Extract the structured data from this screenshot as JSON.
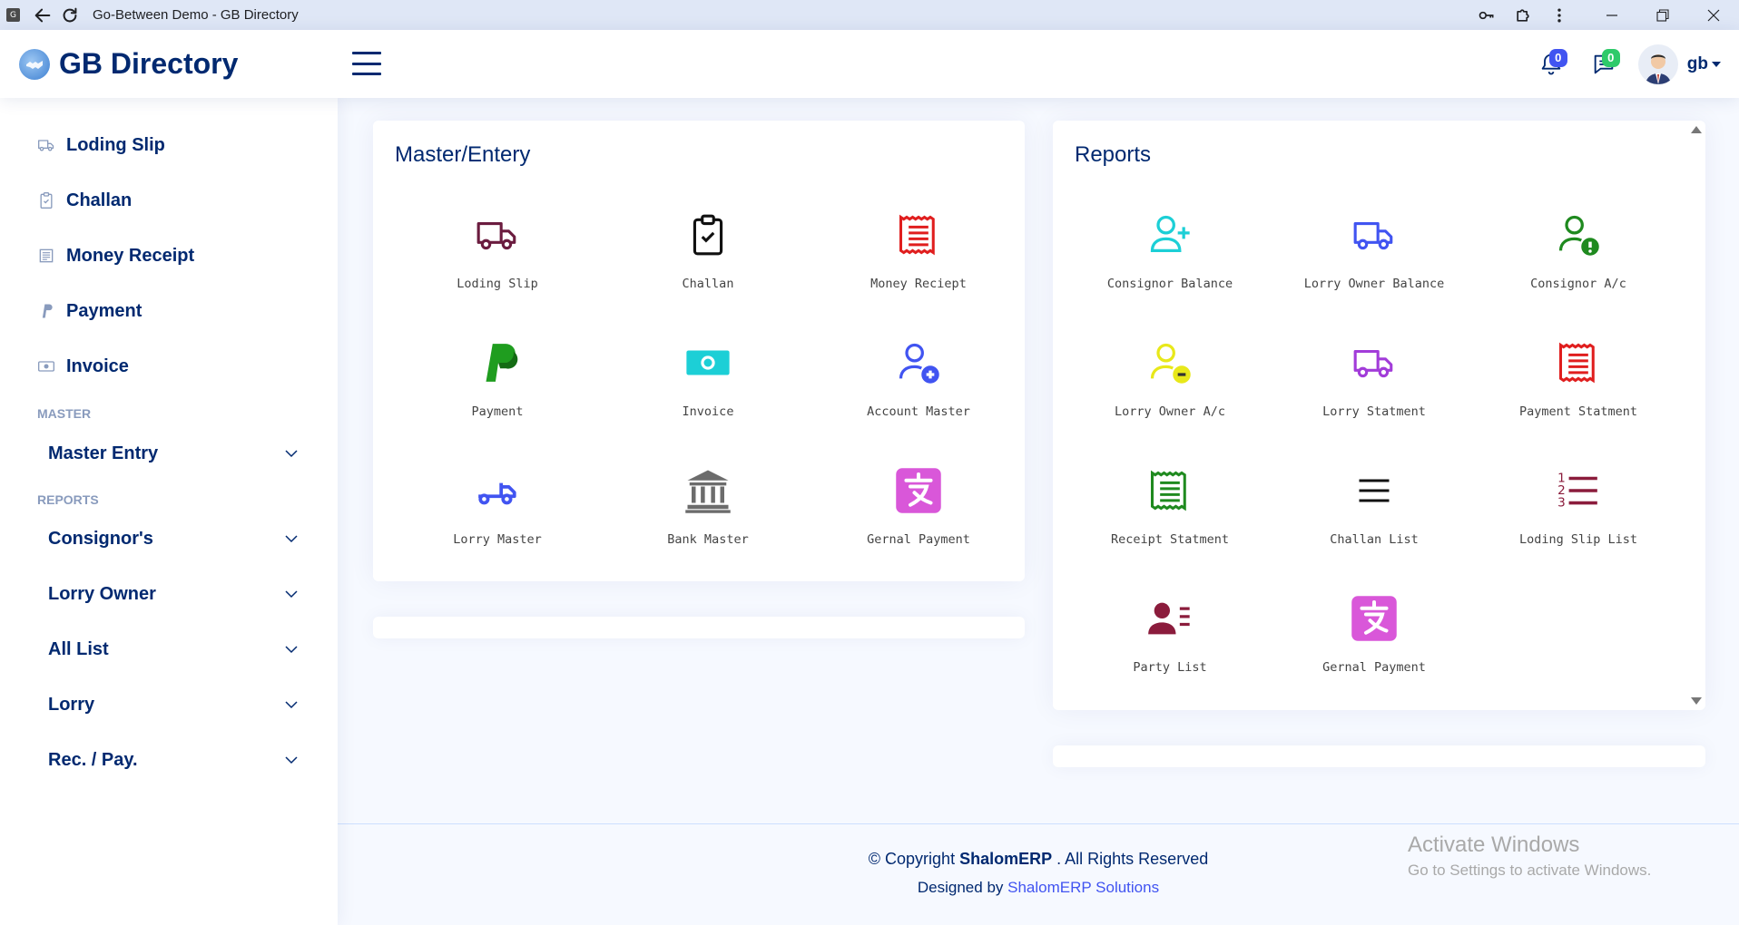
{
  "browser": {
    "title": "Go-Between Demo - GB Directory"
  },
  "header": {
    "logo_text": "GB Directory",
    "notifications_count": "0",
    "messages_count": "0",
    "user_name": "gb"
  },
  "sidebar": {
    "items": [
      {
        "label": "Loding Slip",
        "icon": "truck-icon"
      },
      {
        "label": "Challan",
        "icon": "clipboard-check-icon"
      },
      {
        "label": "Money Receipt",
        "icon": "receipt-icon"
      },
      {
        "label": "Payment",
        "icon": "paypal-icon"
      },
      {
        "label": "Invoice",
        "icon": "cash-icon"
      }
    ],
    "master_heading": "MASTER",
    "master_dropdowns": [
      {
        "label": "Master Entry"
      }
    ],
    "reports_heading": "REPORTS",
    "report_dropdowns": [
      {
        "label": "Consignor's"
      },
      {
        "label": "Lorry Owner"
      },
      {
        "label": "All List"
      },
      {
        "label": "Lorry"
      },
      {
        "label": "Rec. / Pay."
      }
    ]
  },
  "master_card": {
    "title": "Master/Entery",
    "tiles": [
      {
        "label": "Loding Slip",
        "icon": "truck-icon",
        "color": "#6b1c3f"
      },
      {
        "label": "Challan",
        "icon": "clipboard-check-icon",
        "color": "#111111"
      },
      {
        "label": "Money Reciept",
        "icon": "receipt-icon",
        "color": "#e01e1e"
      },
      {
        "label": "Payment",
        "icon": "paypal-icon",
        "color": "#1f9d1f"
      },
      {
        "label": "Invoice",
        "icon": "cash-icon",
        "color": "#1ccfd6"
      },
      {
        "label": "Account Master",
        "icon": "person-plus-icon",
        "color": "#4154f1"
      },
      {
        "label": "Lorry Master",
        "icon": "truck-flatbed-icon",
        "color": "#4154f1"
      },
      {
        "label": "Bank Master",
        "icon": "bank-icon",
        "color": "#6c6c6c"
      },
      {
        "label": "Gernal Payment",
        "icon": "alipay-icon",
        "color": "#d957d9"
      }
    ]
  },
  "reports_card": {
    "title": "Reports",
    "tiles": [
      {
        "label": "Consignor Balance",
        "icon": "person-plus-icon",
        "color": "#1ccfd6"
      },
      {
        "label": "Lorry Owner Balance",
        "icon": "truck-icon",
        "color": "#4154f1"
      },
      {
        "label": "Consignor A/c",
        "icon": "person-exclamation-icon",
        "color": "#1f8a1f"
      },
      {
        "label": "Lorry Owner A/c",
        "icon": "person-dash-icon",
        "color": "#e8e81a"
      },
      {
        "label": "Lorry Statment",
        "icon": "truck-icon",
        "color": "#a23cd9"
      },
      {
        "label": "Payment Statment",
        "icon": "receipt-icon",
        "color": "#e01e1e"
      },
      {
        "label": "Receipt Statment",
        "icon": "receipt-icon",
        "color": "#1f8a1f"
      },
      {
        "label": "Challan List",
        "icon": "list-icon",
        "color": "#111111"
      },
      {
        "label": "Loding Slip List",
        "icon": "list-ol-icon",
        "color": "#8b1c3c"
      },
      {
        "label": "Party List",
        "icon": "person-lines-icon",
        "color": "#8b1c3c"
      },
      {
        "label": "Gernal Payment",
        "icon": "alipay-icon",
        "color": "#d957d9"
      }
    ]
  },
  "footer": {
    "copyright_prefix": "© Copyright",
    "brand": "ShalomERP",
    "copyright_suffix": ". All Rights Reserved",
    "designed_by": "Designed by",
    "designer_link": "ShalomERP Solutions"
  },
  "watermark": {
    "line1": "Activate Windows",
    "line2": "Go to Settings to activate Windows."
  }
}
